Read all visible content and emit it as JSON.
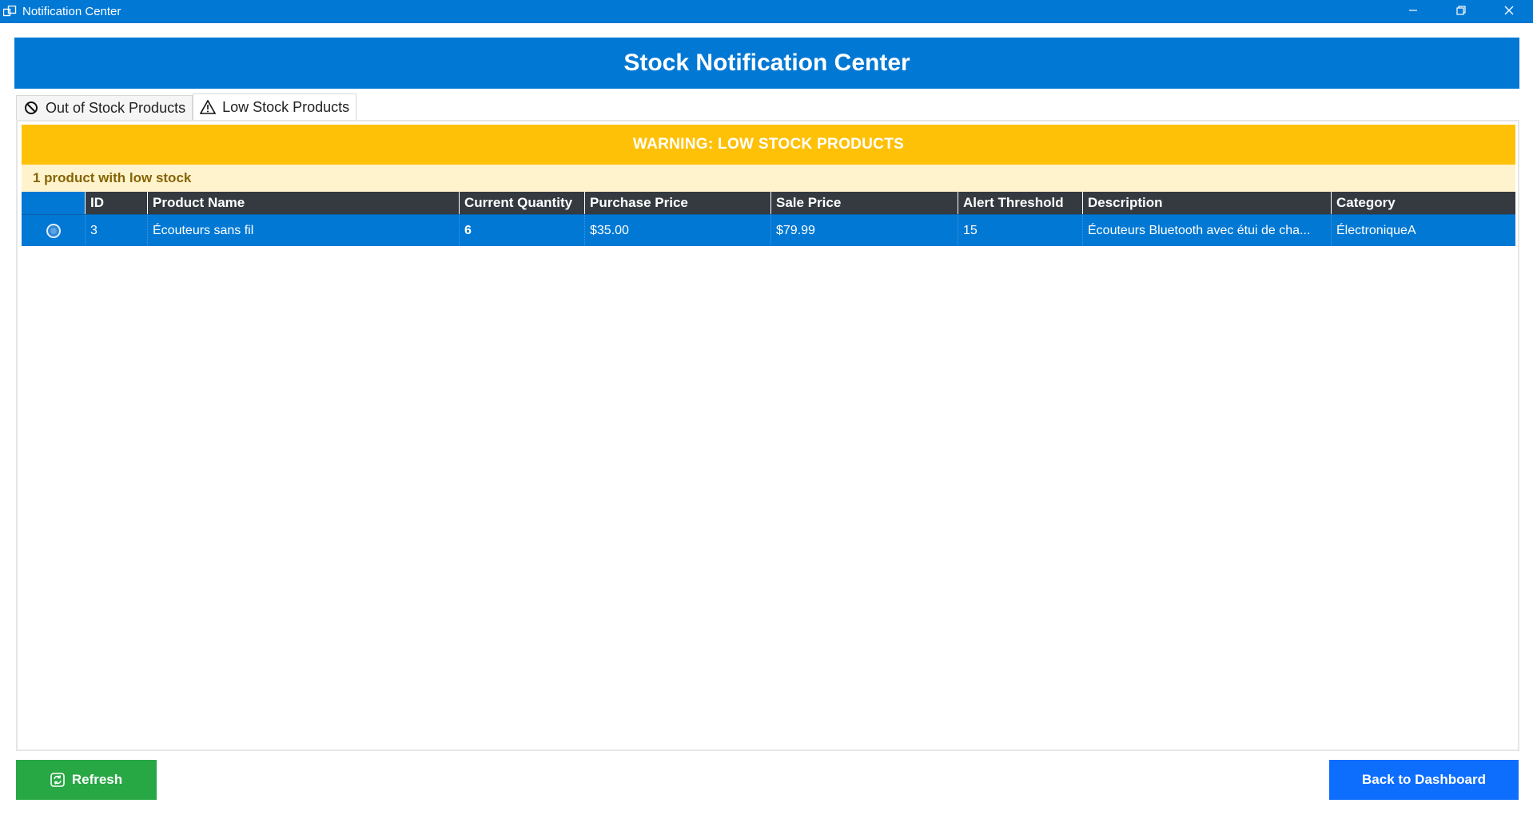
{
  "window": {
    "title": "Notification Center",
    "app_icon": "window-app-icon",
    "controls": [
      "minimize-icon",
      "restore-icon",
      "close-icon"
    ]
  },
  "header": {
    "title": "Stock Notification Center"
  },
  "tabs": [
    {
      "label": "Out of Stock Products",
      "icon": "prohibited-icon",
      "active": false
    },
    {
      "label": "Low Stock Products",
      "icon": "warning-icon",
      "active": true
    }
  ],
  "panel": {
    "warning": "WARNING: LOW STOCK PRODUCTS",
    "count": "1 product with low stock",
    "columns": [
      "",
      "ID",
      "Product Name",
      "Current Quantity",
      "Purchase Price",
      "Sale Price",
      "Alert Threshold",
      "Description",
      "Category"
    ],
    "rows": [
      {
        "id": "3",
        "product_name": "Écouteurs sans fil",
        "current_quantity": "6",
        "purchase_price": "$35.00",
        "sale_price": "$79.99",
        "alert_threshold": "15",
        "description": "Écouteurs Bluetooth avec étui de cha...",
        "category": "ÉlectroniqueA"
      }
    ]
  },
  "buttons": {
    "refresh": "Refresh",
    "back": "Back to Dashboard"
  },
  "colors": {
    "primary": "#0078d4",
    "warning": "#ffc107",
    "warning_light": "#fff3cd",
    "warning_text": "#856404",
    "header_dark": "#343a40",
    "success": "#28a745",
    "button_blue": "#0d6efd"
  }
}
